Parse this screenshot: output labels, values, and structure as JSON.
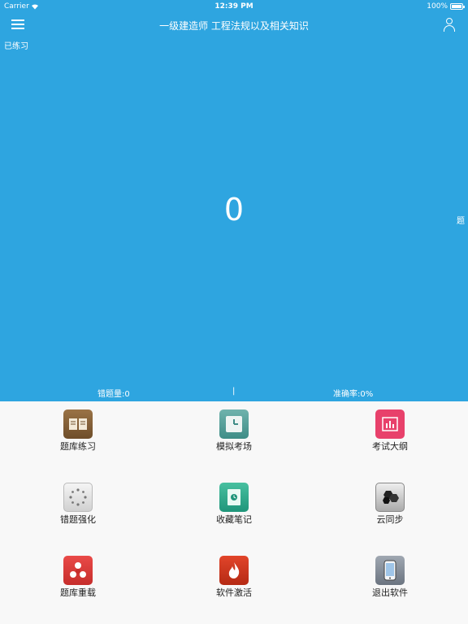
{
  "status_bar": {
    "carrier": "Carrier",
    "time": "12:39 PM",
    "battery": "100%"
  },
  "nav": {
    "title": "一级建造师 工程法规以及相关知识"
  },
  "summary": {
    "practiced_label": "已练习",
    "count": "0",
    "side_label": "题",
    "wrong_count": "错题量:0",
    "separator": "|",
    "accuracy": "准确率:0%"
  },
  "menu": [
    {
      "label": "题库练习",
      "icon": "book-icon",
      "color": "#8a6237"
    },
    {
      "label": "模拟考场",
      "icon": "clock-icon",
      "color": "#4f9c96"
    },
    {
      "label": "考试大纲",
      "icon": "bar-chart-icon",
      "color": "#e8416b"
    },
    {
      "label": "错题强化",
      "icon": "sparkle-icon",
      "color": "#dddddd"
    },
    {
      "label": "收藏笔记",
      "icon": "note-icon",
      "color": "#2aa886"
    },
    {
      "label": "云同步",
      "icon": "sync-icon",
      "color": "#555555"
    },
    {
      "label": "题库重载",
      "icon": "reload-icon",
      "color": "#d83a38"
    },
    {
      "label": "软件激活",
      "icon": "flame-icon",
      "color": "#cc3a20"
    },
    {
      "label": "退出软件",
      "icon": "phone-icon",
      "color": "#7c8590"
    }
  ]
}
